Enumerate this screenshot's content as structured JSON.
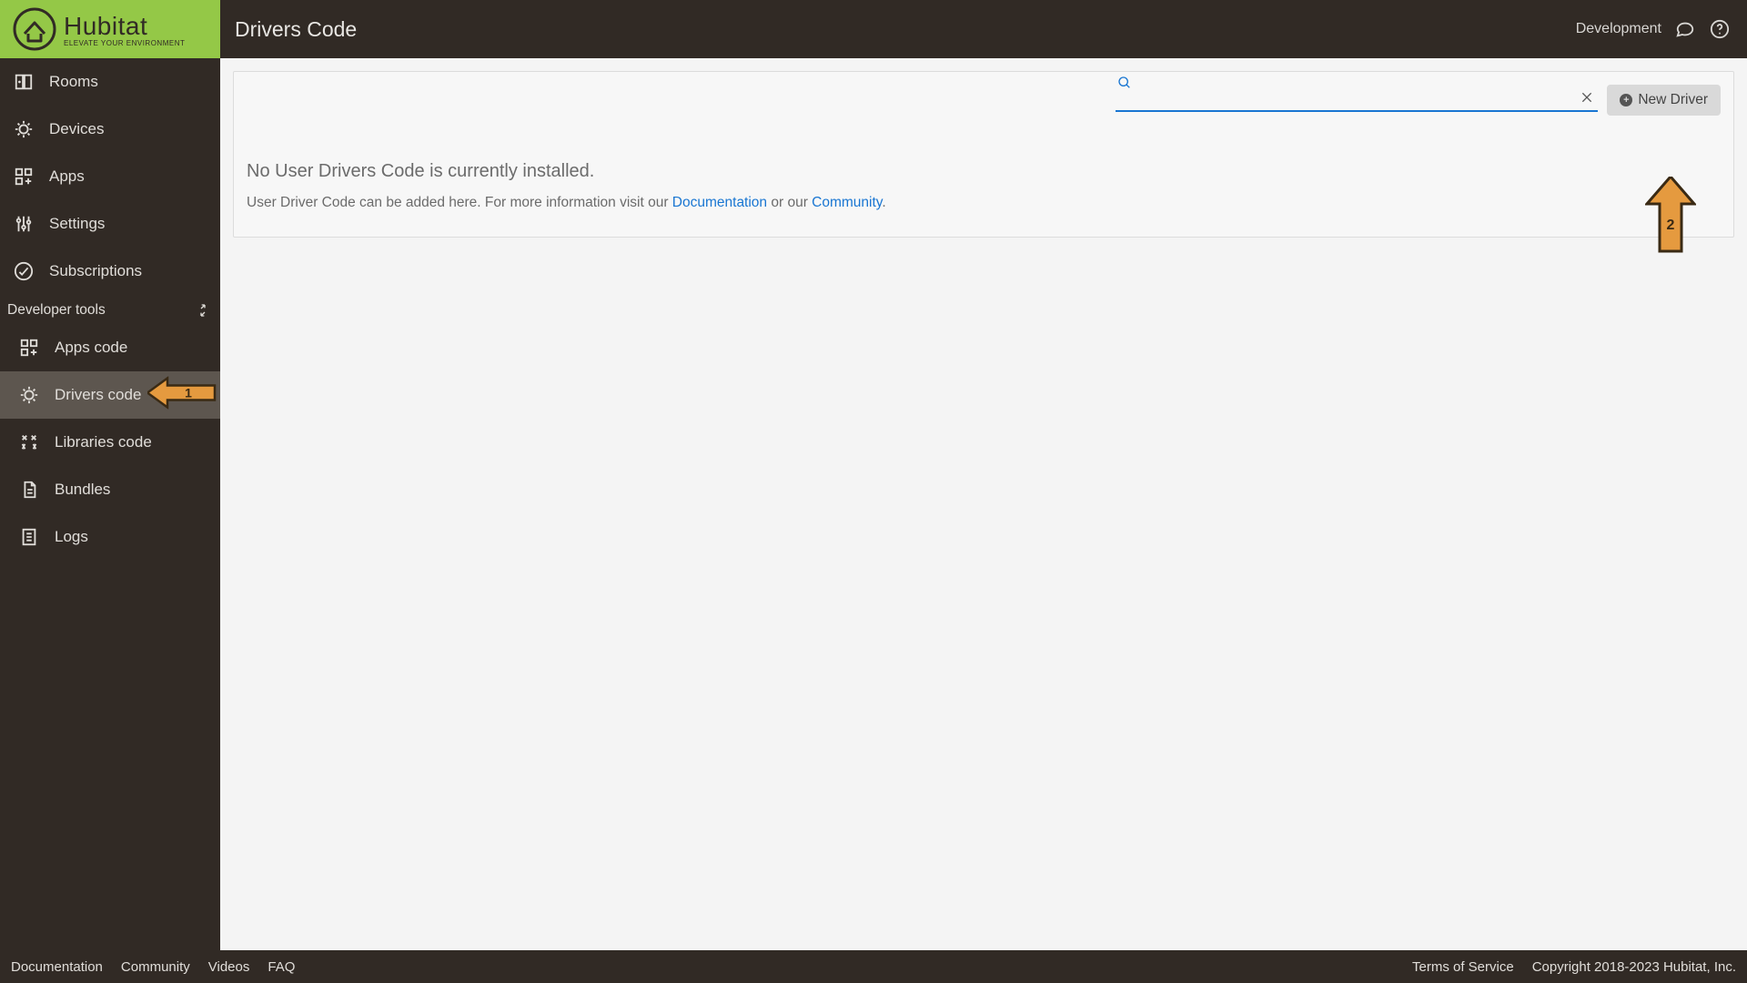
{
  "header": {
    "brand": "Hubitat",
    "tagline": "ELEVATE YOUR ENVIRONMENT",
    "page_title": "Drivers Code",
    "env_label": "Development"
  },
  "sidebar": {
    "main_items": [
      {
        "label": "Rooms"
      },
      {
        "label": "Devices"
      },
      {
        "label": "Apps"
      },
      {
        "label": "Settings"
      },
      {
        "label": "Subscriptions"
      }
    ],
    "group_label": "Developer tools",
    "dev_items": [
      {
        "label": "Apps code"
      },
      {
        "label": "Drivers code"
      },
      {
        "label": "Libraries code"
      },
      {
        "label": "Bundles"
      },
      {
        "label": "Logs"
      }
    ]
  },
  "panel": {
    "new_driver_label": "New Driver",
    "search_value": "",
    "empty_title": "No User Drivers Code is currently installed.",
    "empty_sub_pre": "User Driver Code can be added here. For more information visit our ",
    "doc_link": "Documentation",
    "empty_sub_mid": " or our ",
    "community_link": "Community",
    "empty_sub_post": "."
  },
  "annotations": {
    "arrow_left_label": "1",
    "arrow_up_label": "2"
  },
  "footer": {
    "left_links": [
      "Documentation",
      "Community",
      "Videos",
      "FAQ"
    ],
    "tos": "Terms of Service",
    "copyright": "Copyright 2018-2023 Hubitat, Inc."
  }
}
